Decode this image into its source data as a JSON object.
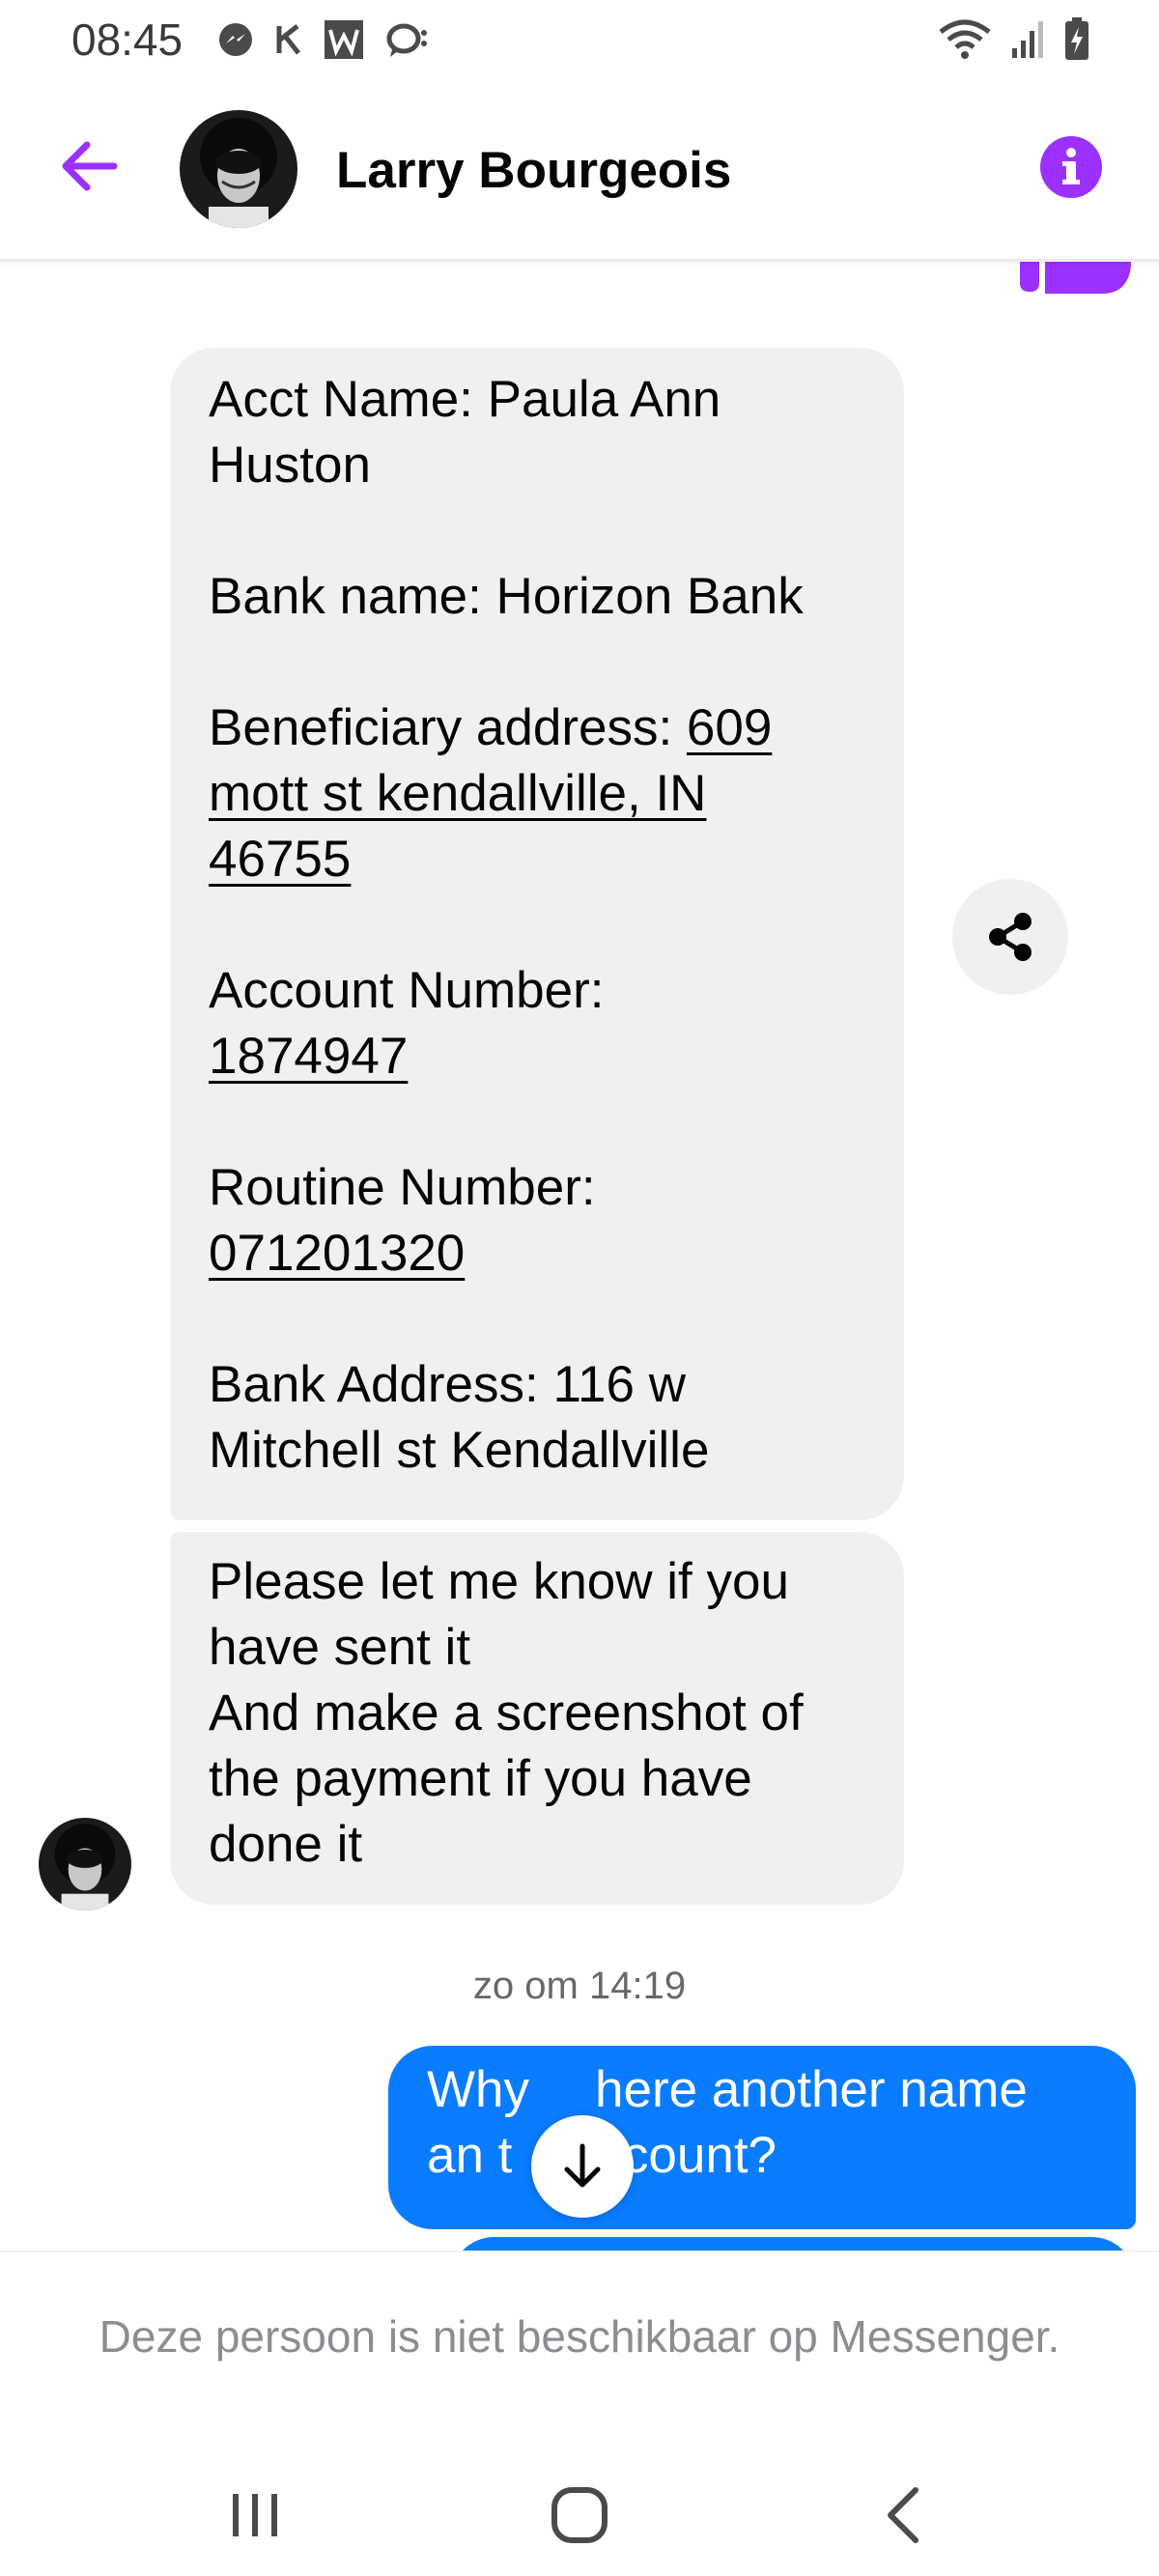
{
  "status_bar": {
    "time": "08:45",
    "left_icons": [
      "messenger-icon",
      "k-icon",
      "w-icon",
      "chat-bubble-icon"
    ],
    "right_icons": [
      "wifi-icon",
      "signal-icon",
      "battery-icon"
    ]
  },
  "header": {
    "contact_name": "Larry Bourgeois",
    "accent_color": "#9b30ff"
  },
  "messages": {
    "bank_details": {
      "acct_name_1": "Acct Name: Paula Ann",
      "acct_name_2": "Huston",
      "bank_name": "Bank name: Horizon Bank",
      "beneficiary_label": "Beneficiary address: ",
      "beneficiary_1": "609",
      "beneficiary_2": "mott st kendallville, IN",
      "beneficiary_3": "46755",
      "account_label": "Account Number:",
      "account_value": "1874947",
      "routine_label": "Routine Number:",
      "routine_value": "071201320",
      "bank_address_1": "Bank Address: 116 w",
      "bank_address_2": "Mitchell st Kendallville"
    },
    "followup": {
      "line1": "Please let me know if you",
      "line2": "have sent it",
      "line3": "And make a screenshot of",
      "line4": "the payment if you have",
      "line5": "done it"
    },
    "timestamp": "zo om 14:19",
    "outgoing": {
      "line1_a": "Why",
      "line1_b": "here another name",
      "line2_a": "an t",
      "line2_b": "ccount?"
    },
    "incoming_color": "#f0f0f0",
    "outgoing_color": "#0a7cff"
  },
  "composer": {
    "unavailable_text": "Deze persoon is niet beschikbaar op Messenger."
  },
  "nav_bar": {
    "buttons": [
      "recent-apps",
      "home",
      "back"
    ]
  }
}
